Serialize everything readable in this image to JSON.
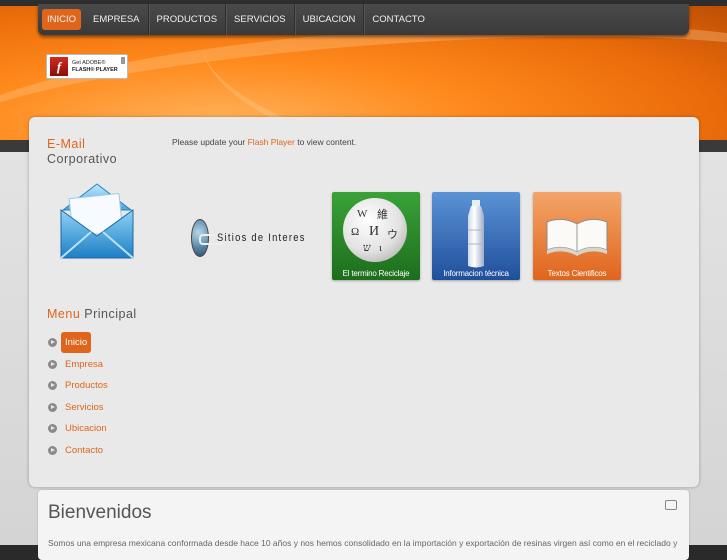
{
  "nav": {
    "items": [
      {
        "label": "INICIO",
        "active": true
      },
      {
        "label": "EMPRESA"
      },
      {
        "label": "PRODUCTOS"
      },
      {
        "label": "SERVICIOS"
      },
      {
        "label": "UBICACION"
      },
      {
        "label": "CONTACTO"
      }
    ]
  },
  "flash_badge": {
    "line1": "Get ADOBE®",
    "line2": "FLASH® PLAYER",
    "icon": "f"
  },
  "email": {
    "title_word1": "E-Mail",
    "title_word2": "Corporativo"
  },
  "menu": {
    "title_word1": "Menu",
    "title_word2": "Principal",
    "items": [
      {
        "label": "Inicio",
        "active": true
      },
      {
        "label": "Empresa"
      },
      {
        "label": "Productos"
      },
      {
        "label": "Servicios"
      },
      {
        "label": "Ubicacion"
      },
      {
        "label": "Contacto"
      }
    ]
  },
  "flash_notice": {
    "before": "Please update your ",
    "link": "Flash Player",
    "after": " to view content."
  },
  "sitios": {
    "label": "Sitios de Interes"
  },
  "tiles": [
    {
      "label": "El termino Reciclaje",
      "color": "#3aa238",
      "icon": "wikipedia-globe-icon"
    },
    {
      "label": "Informacion técnica",
      "color": "#2f6bbf",
      "icon": "bottle-icon"
    },
    {
      "label": "Textos Cientificos",
      "color": "#e0651c",
      "icon": "book-icon"
    }
  ],
  "welcome": {
    "title": "Bienvenidos",
    "text": "Somos una empresa mexicana conformada desde hace 10 años y nos hemos consolidado en la importación y exportación de resinas virgen así como en el reciclado y"
  },
  "colors": {
    "accent": "#e0651c",
    "nav_bg": "#3f3f3f"
  }
}
